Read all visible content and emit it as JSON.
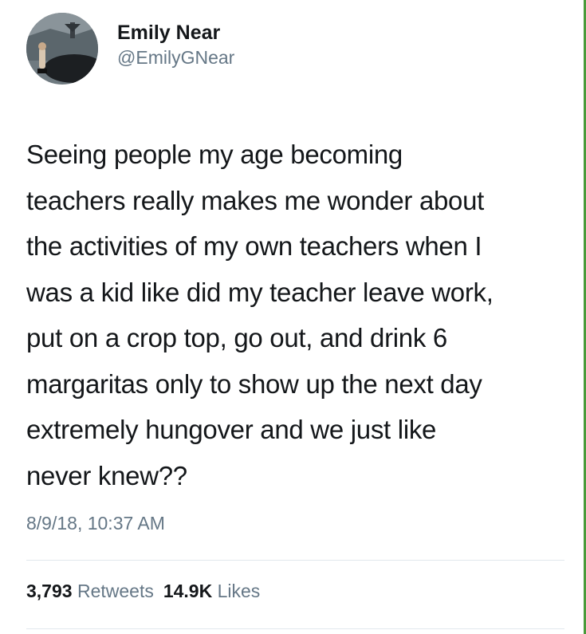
{
  "user": {
    "display_name": "Emily Near",
    "handle": "@EmilyGNear"
  },
  "tweet": {
    "lines": [
      "Seeing people my age becoming",
      "teachers really makes me wonder about",
      "the activities of my own teachers when I",
      "was a kid like did my teacher leave work,",
      "put on a crop top, go out, and drink 6",
      "margaritas only to show up the next day",
      "extremely hungover and we just like",
      "never knew??"
    ],
    "timestamp": "8/9/18, 10:37 AM"
  },
  "stats": {
    "retweets_count": "3,793",
    "retweets_label": "Retweets",
    "likes_count": "14.9K",
    "likes_label": "Likes"
  },
  "colors": {
    "text": "#14171a",
    "secondary": "#657786",
    "divider": "#e1e8ed",
    "edge": "#4a9a3a"
  }
}
